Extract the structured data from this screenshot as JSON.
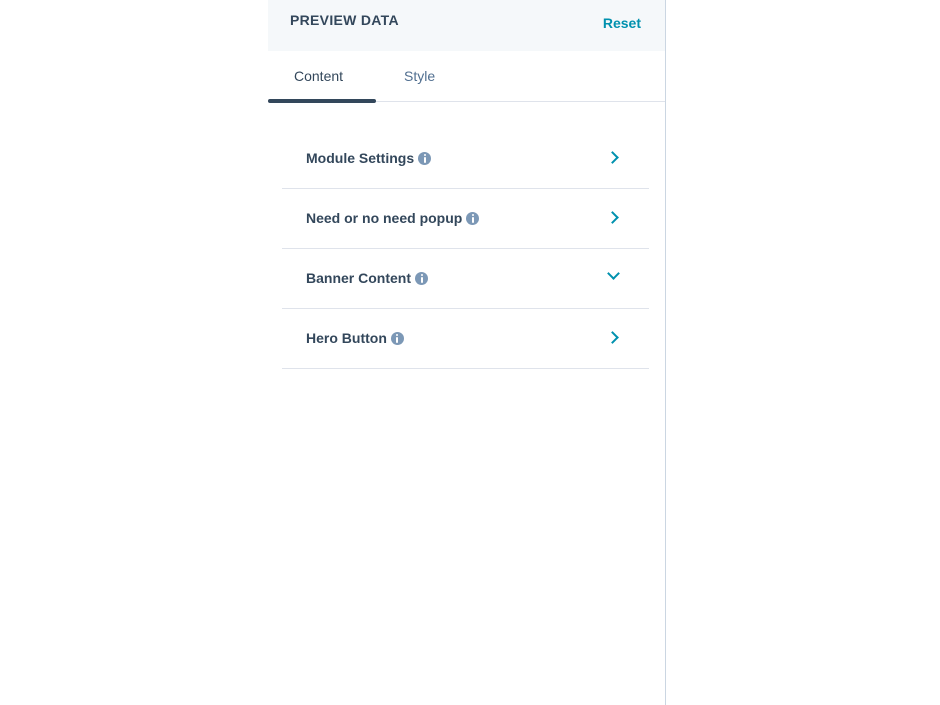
{
  "panel": {
    "title": "PREVIEW DATA",
    "reset_label": "Reset"
  },
  "tabs": [
    {
      "label": "Content",
      "active": true
    },
    {
      "label": "Style",
      "active": false
    }
  ],
  "sections": [
    {
      "label": "Module Settings",
      "icon": "chevron-right-icon",
      "expanded": false
    },
    {
      "label": "Need or no need popup",
      "icon": "chevron-right-icon",
      "expanded": false
    },
    {
      "label": "Banner Content",
      "icon": "chevron-down-icon",
      "expanded": true
    },
    {
      "label": "Hero Button",
      "icon": "chevron-right-icon",
      "expanded": false
    }
  ],
  "colors": {
    "accent": "#0091ae",
    "text": "#33475b",
    "header_bg": "#f5f8fa",
    "info_icon": "#7c98b6"
  }
}
